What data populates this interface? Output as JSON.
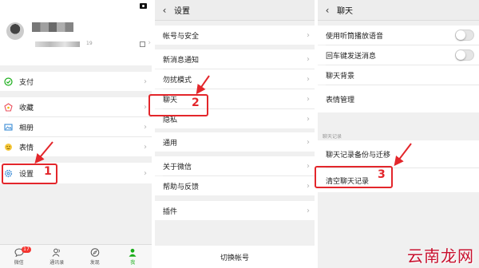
{
  "me_panel": {
    "user_id_fragment": "19",
    "menu": [
      {
        "label": "支付",
        "icon": "pay-icon"
      },
      {
        "label": "收藏",
        "icon": "favorites-icon"
      },
      {
        "label": "相册",
        "icon": "album-icon"
      },
      {
        "label": "表情",
        "icon": "sticker-icon"
      },
      {
        "label": "设置",
        "icon": "settings-icon"
      }
    ],
    "tabs": [
      {
        "label": "微信",
        "badge": "17",
        "icon": "chats-icon"
      },
      {
        "label": "通讯录",
        "icon": "contacts-icon"
      },
      {
        "label": "发现",
        "icon": "discover-icon"
      },
      {
        "label": "我",
        "icon": "me-icon",
        "active": true
      }
    ]
  },
  "settings_panel": {
    "title": "设置",
    "items": [
      "帐号与安全",
      "新消息通知",
      "勿扰模式",
      "聊天",
      "隐私",
      "通用",
      "关于微信",
      "帮助与反馈",
      "插件"
    ],
    "switch_account": "切换帐号"
  },
  "chat_panel": {
    "title": "聊天",
    "toggles": [
      {
        "label": "使用听筒播放语音",
        "on": false
      },
      {
        "label": "回车键发送消息",
        "on": false
      }
    ],
    "items": [
      "聊天背景",
      "表情管理"
    ],
    "section_label": "聊天记录",
    "history_items": [
      "聊天记录备份与迁移",
      "清空聊天记录"
    ]
  },
  "annotations": {
    "step1": "1",
    "step2": "2",
    "step3": "3",
    "highlight_color": "#e3262b"
  },
  "watermark": "云南龙网"
}
